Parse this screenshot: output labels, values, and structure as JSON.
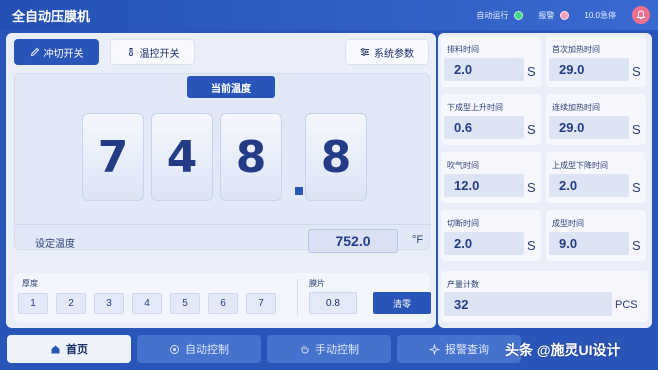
{
  "header": {
    "title": "全自动压膜机",
    "statuses": [
      {
        "label": "自动运行",
        "color": "#3fd88a"
      },
      {
        "label": "报警",
        "color": "#f5a0b8"
      },
      {
        "label": "10.0急停",
        "color": "#f5a0b8"
      }
    ]
  },
  "controls": {
    "cut_switch": "冲切开关",
    "temp_switch": "温控开关",
    "system_params": "系统参数"
  },
  "temperature": {
    "tab_label": "当前温度",
    "digits": [
      "7",
      "4",
      "8",
      "8"
    ],
    "set_label": "设定温度",
    "set_value": "752.0",
    "unit": "°F"
  },
  "thickness": {
    "label": "厚度",
    "options": [
      "1",
      "2",
      "3",
      "4",
      "5",
      "6",
      "7"
    ]
  },
  "film": {
    "label": "膜片",
    "value": "0.8",
    "clear_label": "清零"
  },
  "params": [
    {
      "title": "排料时间",
      "value": "2.0",
      "unit": "S"
    },
    {
      "title": "首次加热时间",
      "value": "29.0",
      "unit": "S"
    },
    {
      "title": "下成型上升时间",
      "value": "0.6",
      "unit": "S"
    },
    {
      "title": "连续加热时间",
      "value": "29.0",
      "unit": "S"
    },
    {
      "title": "吹气时间",
      "value": "12.0",
      "unit": "S"
    },
    {
      "title": "上成型下降时间",
      "value": "2.0",
      "unit": "S"
    },
    {
      "title": "切断时间",
      "value": "2.0",
      "unit": "S"
    },
    {
      "title": "成型时间",
      "value": "9.0",
      "unit": "S"
    }
  ],
  "counter": {
    "title": "产量计数",
    "value": "32",
    "unit": "PCS"
  },
  "nav": [
    {
      "label": "首页",
      "icon": "home-icon"
    },
    {
      "label": "自动控制",
      "icon": "auto-control-icon"
    },
    {
      "label": "手动控制",
      "icon": "hand-icon"
    },
    {
      "label": "报警查询",
      "icon": "alarm-icon"
    }
  ],
  "watermark": "头条 @施灵UI设计"
}
